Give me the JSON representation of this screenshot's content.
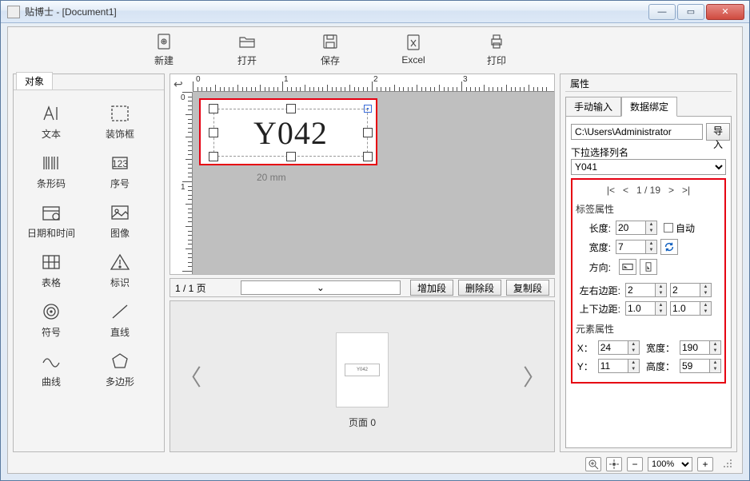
{
  "window": {
    "title": "贴博士 - [Document1]"
  },
  "toolbar": {
    "new": "新建",
    "open": "打开",
    "save": "保存",
    "excel": "Excel",
    "print": "打印"
  },
  "left": {
    "tab": "对象",
    "items": [
      {
        "label": "文本"
      },
      {
        "label": "装饰框"
      },
      {
        "label": "条形码"
      },
      {
        "label": "序号"
      },
      {
        "label": "日期和时间"
      },
      {
        "label": "图像"
      },
      {
        "label": "表格"
      },
      {
        "label": "标识"
      },
      {
        "label": "符号"
      },
      {
        "label": "直线"
      },
      {
        "label": "曲线"
      },
      {
        "label": "多边形"
      }
    ]
  },
  "canvas": {
    "text": "Y042",
    "dim": "20 mm",
    "page_text": "1 / 1 页",
    "add_seg": "增加段",
    "del_seg": "删除段",
    "copy_seg": "复制段"
  },
  "preview": {
    "thumb_text": "Y042",
    "thumb_label": "页面 0"
  },
  "right": {
    "panel_title": "属性",
    "tab_manual": "手动输入",
    "tab_data": "数据绑定",
    "path": "C:\\Users\\Administrator",
    "import_btn": "导入",
    "column_title": "下拉选择列名",
    "column_value": "Y041",
    "pager": {
      "first": "|<",
      "prev": "<",
      "pos": "1 / 19",
      "next": ">",
      "last": ">|"
    },
    "label_props_title": "标签属性",
    "length_label": "长度:",
    "length_val": "20",
    "auto_label": "自动",
    "width_label": "宽度:",
    "width_val": "7",
    "orient_label": "方向:",
    "lr_margin_label": "左右边距:",
    "lr_a": "2",
    "lr_b": "2",
    "tb_margin_label": "上下边距:",
    "tb_a": "1.0",
    "tb_b": "1.0",
    "elem_props_title": "元素属性",
    "x_label": "X：",
    "x_val": "24",
    "ew_label": "宽度：",
    "ew_val": "190",
    "y_label": "Y：",
    "y_val": "11",
    "eh_label": "高度：",
    "eh_val": "59"
  },
  "status": {
    "zoom": "100%"
  }
}
